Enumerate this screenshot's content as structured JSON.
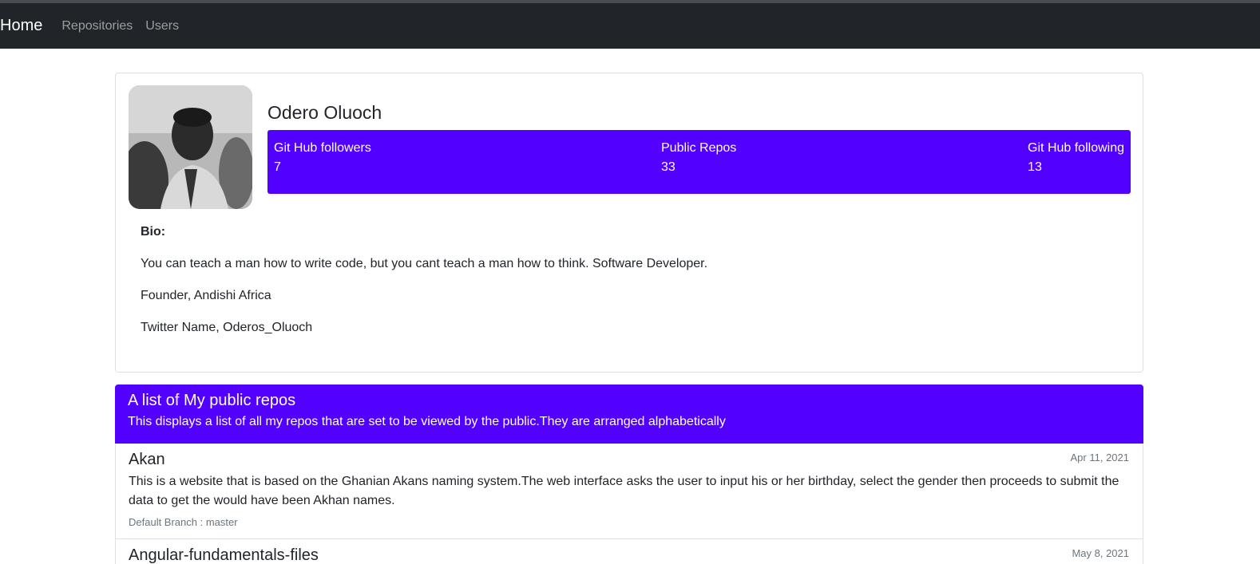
{
  "nav": {
    "brand": "Home",
    "links": [
      "Repositories",
      "Users"
    ]
  },
  "profile": {
    "name": "Odero Oluoch",
    "stats": [
      {
        "label": "Git Hub followers",
        "value": "7"
      },
      {
        "label": "Public Repos",
        "value": "33"
      },
      {
        "label": "Git Hub following",
        "value": "13"
      }
    ],
    "bio_label": "Bio:",
    "bio_lines": [
      "You can teach a man how to write code, but you cant teach a man how to think. Software Developer.",
      "Founder, Andishi Africa",
      "Twitter Name, Oderos_Oluoch"
    ]
  },
  "repos": {
    "title": "A list of My public repos",
    "subtitle": "This displays a list of all my repos that are set to be viewed by the public.They are arranged alphabetically",
    "items": [
      {
        "name": "Akan",
        "date": "Apr 11, 2021",
        "description": "This is a website that is based on the Ghanian Akans naming system.The web interface asks the user to input his or her birthday, select the gender then proceeds to submit the data to get the would have been Akhan names.",
        "branch": "Default Branch : master"
      },
      {
        "name": "Angular-fundamentals-files",
        "date": "May 8, 2021",
        "description": "",
        "branch": ""
      }
    ]
  },
  "colors": {
    "navbar": "#212529",
    "accent": "#5200ff"
  },
  "icons": {
    "avatar": "profile-photo"
  }
}
